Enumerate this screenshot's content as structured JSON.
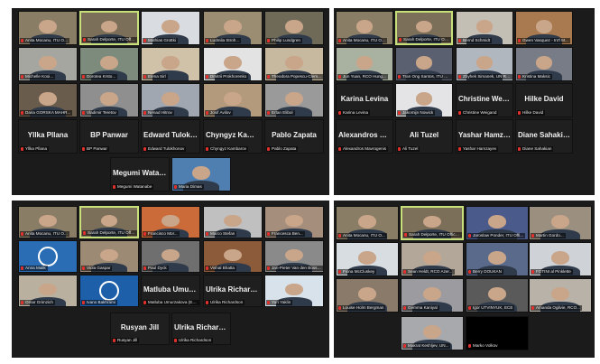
{
  "grids": [
    {
      "tiles": [
        {
          "label": "Anita Mocanu, ITU O...",
          "bg": "#8a7d66"
        },
        {
          "label": "Sarah Delporte, ITU Office",
          "bg": "#7c6f5a",
          "speaking": true
        },
        {
          "label": "Mathias Grottki",
          "bg": "#d9dce0"
        },
        {
          "label": "Ludmila Stroh...",
          "bg": "#9b8d72"
        },
        {
          "label": "Philip Lundgren",
          "bg": "#6f6a58"
        },
        {
          "label": "Michelle Kooi...",
          "bg": "#a6a6a0"
        },
        {
          "label": "Dorotea Krsto...",
          "bg": "#7c8b7c"
        },
        {
          "label": "Elena Sirl",
          "bg": "#cfc2a8"
        },
        {
          "label": "Dmitrii Prokhorenko",
          "bg": "#e3e3e3"
        },
        {
          "label": "Theodora Popescu-Clem...",
          "bg": "#c7b9a0"
        },
        {
          "label": "Daria GORSKA MAHR...",
          "bg": "#6a5c4c"
        },
        {
          "label": "Vladimir Teretov",
          "bg": "#8f8f8f"
        },
        {
          "label": "Nenad Hitrov",
          "bg": "#a1a7b0"
        },
        {
          "label": "Josif Avilov",
          "bg": "#b49a7c"
        },
        {
          "label": "Ertan Elibol",
          "bg": "#9a9a9a"
        },
        {
          "label": "Yllka Pllana",
          "big": "Yllka Pllana"
        },
        {
          "label": "BP Panwar",
          "big": "BP Panwar"
        },
        {
          "label": "Edward Tulokhonov",
          "big": "Edward Tulokh..."
        },
        {
          "label": "Chyngyz Kambarov",
          "big": "Chyngyz Kamb..."
        },
        {
          "label": "Pablo Zapata",
          "big": "Pablo Zapata"
        },
        {
          "label": "Megumi Watanabe",
          "big": "Megumi Watan..."
        },
        {
          "label": "Maria Dimas",
          "bg": "#4f7fb0"
        }
      ]
    },
    {
      "tiles": [
        {
          "label": "Anita Mocanu, ITU O...",
          "bg": "#8a7d66"
        },
        {
          "label": "Sarah Delporte, ITU Office...",
          "bg": "#7c6f5a",
          "speaking": true
        },
        {
          "label": "Bernd Schmidt",
          "bg": "#c4bfb5"
        },
        {
          "label": "Gwen Vasquez - Int'l M...",
          "bg": "#a97a4f"
        },
        {
          "label": "Jun Yuan, RCO Hung...",
          "bg": "#a9b1a0"
        },
        {
          "label": "Tran Ong Santos, ITU Of...",
          "bg": "#5a6070"
        },
        {
          "label": "Zbyhek Simanek, UN RC...",
          "bg": "#b0b7bf"
        },
        {
          "label": "Kristina Maksic",
          "bg": "#777c86"
        },
        {
          "label": "Karina Levina",
          "big": "Karina Levina"
        },
        {
          "label": "Jakomijn Nowick",
          "bg": "#e4e4e6"
        },
        {
          "label": "Christine Weigand",
          "big": "Christine Weiga..."
        },
        {
          "label": "Hilke David",
          "big": "Hilke David"
        },
        {
          "label": "Alexandros Mavrogenis",
          "big": "Alexandros Ma..."
        },
        {
          "label": "Ali Tuzel",
          "big": "Ali Tuzel"
        },
        {
          "label": "Yashar Hamzayev",
          "big": "Yashar Hamzayev"
        },
        {
          "label": "Diane Sahakian",
          "big": "Diane Sahakian"
        }
      ]
    },
    {
      "tiles": [
        {
          "label": "Anita Mocanu, ITU O...",
          "bg": "#8a7d66"
        },
        {
          "label": "Sarah Delporte, ITU Offic...",
          "bg": "#7c6f5a",
          "speaking": true
        },
        {
          "label": "Francisco Mor...",
          "bg": "#cb6b3a"
        },
        {
          "label": "Marco Stefan",
          "bg": "#c0c0c0"
        },
        {
          "label": "Francesca Ben...",
          "bg": "#a58f7c"
        },
        {
          "label": "Anna Malik",
          "bg": "#2b6db5"
        },
        {
          "label": "Viola Gaspar",
          "bg": "#9c8a74"
        },
        {
          "label": "Paul Dyck",
          "bg": "#6f6f6f"
        },
        {
          "label": "Vishal Bhatta",
          "bg": "#8b5b3a"
        },
        {
          "label": "Jan-Pieter Van den Bossc...",
          "bg": "#8a8a8a"
        },
        {
          "label": "Omar Grimzich",
          "bg": "#b9b0a0"
        },
        {
          "label": "Ivano Bakhrami",
          "bg": "#1d5fa8"
        },
        {
          "label": "Matluba Umurzakova (ECE)",
          "big": "Matluba Umurz..."
        },
        {
          "label": "Ulrika Richardson",
          "big": "Ulrika Richardson"
        },
        {
          "label": "Yuri Yaklin",
          "bg": "#d8e2ea"
        },
        {
          "label": "Rusyan Jill",
          "big": "Rusyan Jill"
        },
        {
          "label": "Ulrika Richardson",
          "big": "Ulrika Richardson"
        }
      ]
    },
    {
      "tiles": [
        {
          "label": "Anita Mocanu, ITU O...",
          "bg": "#8a7d66"
        },
        {
          "label": "Sarah Delporte, ITU Office...",
          "bg": "#7c6f5a",
          "speaking": true
        },
        {
          "label": "Jaroslaw Ponder, ITU Offi...",
          "bg": "#4a5a8a"
        },
        {
          "label": "Martin Gordo...",
          "bg": "#9b9080"
        },
        {
          "label": "Fiona McCluskey",
          "bg": "#d8dde2"
        },
        {
          "label": "Sean Heldt, RCO Azer...",
          "bg": "#b3a79a"
        },
        {
          "label": "Berry DOUKAN",
          "bg": "#5a6a8a"
        },
        {
          "label": "FOTINI al Pinklette",
          "bg": "#cfd2d6"
        },
        {
          "label": "Louise Holm Bergman",
          "bg": "#8a7a6a"
        },
        {
          "label": "Gemma Kaniyal",
          "bg": "#9c9ca0"
        },
        {
          "label": "Igor UTVINYUK, ECE",
          "bg": "#5a5a5a"
        },
        {
          "label": "Amanda Ogilvie, RCO...",
          "bg": "#b9b2a8"
        },
        {
          "label": "Makrat Keshljev, UN...",
          "bg": "#a7a9ad"
        },
        {
          "label": "Marko Volkov",
          "bg": "#000000"
        }
      ]
    }
  ]
}
